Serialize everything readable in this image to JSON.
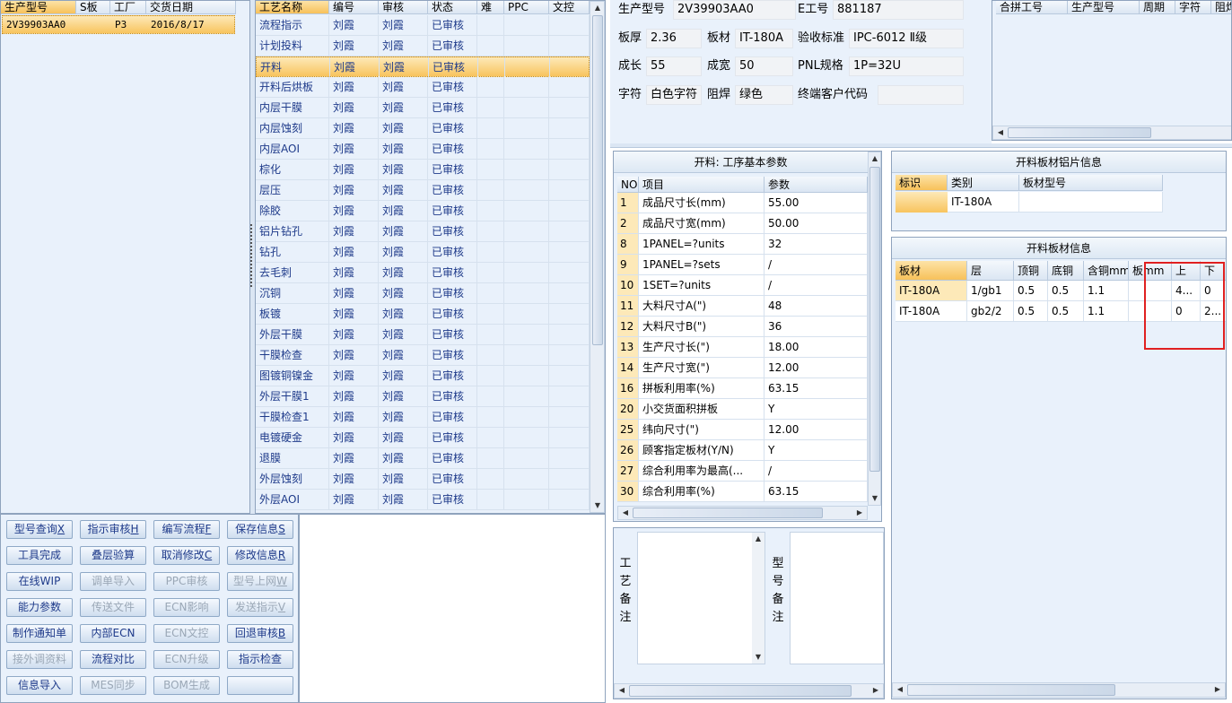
{
  "left_grid": {
    "headers": [
      "生产型号",
      "S板",
      "工厂",
      "交货日期"
    ],
    "rows": [
      {
        "model": "2V39903AA0",
        "s": "",
        "factory": "P3",
        "date": "2016/8/17"
      }
    ]
  },
  "process_grid": {
    "headers": [
      "工艺名称",
      "编号",
      "审核",
      "状态",
      "难",
      "PPC",
      "文控"
    ],
    "rows": [
      {
        "name": "流程指示",
        "no": "刘霞",
        "audit": "刘霞",
        "status": "已审核"
      },
      {
        "name": "计划投料",
        "no": "刘霞",
        "audit": "刘霞",
        "status": "已审核"
      },
      {
        "name": "开料",
        "no": "刘霞",
        "audit": "刘霞",
        "status": "已审核"
      },
      {
        "name": "开料后烘板",
        "no": "刘霞",
        "audit": "刘霞",
        "status": "已审核"
      },
      {
        "name": "内层干膜",
        "no": "刘霞",
        "audit": "刘霞",
        "status": "已审核"
      },
      {
        "name": "内层蚀刻",
        "no": "刘霞",
        "audit": "刘霞",
        "status": "已审核"
      },
      {
        "name": "内层AOI",
        "no": "刘霞",
        "audit": "刘霞",
        "status": "已审核"
      },
      {
        "name": "棕化",
        "no": "刘霞",
        "audit": "刘霞",
        "status": "已审核"
      },
      {
        "name": "层压",
        "no": "刘霞",
        "audit": "刘霞",
        "status": "已审核"
      },
      {
        "name": "除胶",
        "no": "刘霞",
        "audit": "刘霞",
        "status": "已审核"
      },
      {
        "name": "铝片钻孔",
        "no": "刘霞",
        "audit": "刘霞",
        "status": "已审核"
      },
      {
        "name": "钻孔",
        "no": "刘霞",
        "audit": "刘霞",
        "status": "已审核"
      },
      {
        "name": "去毛刺",
        "no": "刘霞",
        "audit": "刘霞",
        "status": "已审核"
      },
      {
        "name": "沉铜",
        "no": "刘霞",
        "audit": "刘霞",
        "status": "已审核"
      },
      {
        "name": "板镀",
        "no": "刘霞",
        "audit": "刘霞",
        "status": "已审核"
      },
      {
        "name": "外层干膜",
        "no": "刘霞",
        "audit": "刘霞",
        "status": "已审核"
      },
      {
        "name": "干膜检查",
        "no": "刘霞",
        "audit": "刘霞",
        "status": "已审核"
      },
      {
        "name": "图镀铜镍金",
        "no": "刘霞",
        "audit": "刘霞",
        "status": "已审核"
      },
      {
        "name": "外层干膜1",
        "no": "刘霞",
        "audit": "刘霞",
        "status": "已审核"
      },
      {
        "name": "干膜检查1",
        "no": "刘霞",
        "audit": "刘霞",
        "status": "已审核"
      },
      {
        "name": "电镀硬金",
        "no": "刘霞",
        "audit": "刘霞",
        "status": "已审核"
      },
      {
        "name": "退膜",
        "no": "刘霞",
        "audit": "刘霞",
        "status": "已审核"
      },
      {
        "name": "外层蚀刻",
        "no": "刘霞",
        "audit": "刘霞",
        "status": "已审核"
      },
      {
        "name": "外层AOI",
        "no": "刘霞",
        "audit": "刘霞",
        "status": "已审核"
      }
    ]
  },
  "buttons": [
    {
      "label": "型号查询",
      "key": "X",
      "disabled": false
    },
    {
      "label": "指示审核",
      "key": "H",
      "disabled": false
    },
    {
      "label": "编写流程",
      "key": "F",
      "disabled": false
    },
    {
      "label": "保存信息",
      "key": "S",
      "disabled": false
    },
    {
      "label": "工具完成",
      "key": "",
      "disabled": false
    },
    {
      "label": "叠层验算",
      "key": "",
      "disabled": false
    },
    {
      "label": "取消修改",
      "key": "C",
      "disabled": false
    },
    {
      "label": "修改信息",
      "key": "R",
      "disabled": false
    },
    {
      "label": "在线WIP",
      "key": "",
      "disabled": false
    },
    {
      "label": "调单导入",
      "key": "",
      "disabled": true
    },
    {
      "label": "PPC审核",
      "key": "",
      "disabled": true
    },
    {
      "label": "型号上网",
      "key": "W",
      "disabled": true
    },
    {
      "label": "能力参数",
      "key": "",
      "disabled": false
    },
    {
      "label": "传送文件",
      "key": "",
      "disabled": true
    },
    {
      "label": "ECN影响",
      "key": "",
      "disabled": true
    },
    {
      "label": "发送指示",
      "key": "V",
      "disabled": true
    },
    {
      "label": "制作通知单",
      "key": "",
      "disabled": false
    },
    {
      "label": "内部ECN",
      "key": "",
      "disabled": false
    },
    {
      "label": "ECN文控",
      "key": "",
      "disabled": true
    },
    {
      "label": "回退审核",
      "key": "B",
      "disabled": false
    },
    {
      "label": "接外调资料",
      "key": "",
      "disabled": true
    },
    {
      "label": "流程对比",
      "key": "",
      "disabled": false
    },
    {
      "label": "ECN升级",
      "key": "",
      "disabled": true
    },
    {
      "label": "指示检查",
      "key": "",
      "disabled": false
    },
    {
      "label": "信息导入",
      "key": "",
      "disabled": false
    },
    {
      "label": "MES同步",
      "key": "",
      "disabled": true
    },
    {
      "label": "BOM生成",
      "key": "",
      "disabled": true
    },
    {
      "label": "",
      "key": "",
      "disabled": false
    }
  ],
  "info": {
    "model_label": "生产型号",
    "model": "2V39903AA0",
    "e_label": "E工号",
    "e_no": "881187",
    "thick_label": "板厚",
    "thick": "2.36",
    "material_label": "板材",
    "material": "IT-180A",
    "std_label": "验收标准",
    "std": "IPC-6012 Ⅱ级",
    "len_label": "成长",
    "len": "55",
    "wid_label": "成宽",
    "wid": "50",
    "pnl_label": "PNL规格",
    "pnl": "1P=32U",
    "char_label": "字符",
    "char": "白色字符",
    "mask_label": "阻焊",
    "mask": "绿色",
    "cust_label": "终端客户代码",
    "cust": ""
  },
  "merge_grid": {
    "headers": [
      "合拼工号",
      "生产型号",
      "周期",
      "字符",
      "阻焊"
    ]
  },
  "params": {
    "title": "开料: 工序基本参数",
    "headers": [
      "NO",
      "项目",
      "参数"
    ],
    "rows": [
      {
        "no": "1",
        "item": "成品尺寸长(mm)",
        "val": "55.00"
      },
      {
        "no": "2",
        "item": "成品尺寸宽(mm)",
        "val": "50.00"
      },
      {
        "no": "8",
        "item": "1PANEL=?units",
        "val": "32"
      },
      {
        "no": "9",
        "item": "1PANEL=?sets",
        "val": "/"
      },
      {
        "no": "10",
        "item": "1SET=?units",
        "val": "/"
      },
      {
        "no": "11",
        "item": "大料尺寸A(\")",
        "val": "48"
      },
      {
        "no": "12",
        "item": "大料尺寸B(\")",
        "val": "36"
      },
      {
        "no": "13",
        "item": "生产尺寸长(\")",
        "val": "18.00"
      },
      {
        "no": "14",
        "item": "生产尺寸宽(\")",
        "val": "12.00"
      },
      {
        "no": "16",
        "item": "拼板利用率(%)",
        "val": "63.15"
      },
      {
        "no": "20",
        "item": "小交货面积拼板",
        "val": "Y"
      },
      {
        "no": "25",
        "item": "纬向尺寸(\")",
        "val": "12.00"
      },
      {
        "no": "26",
        "item": "顾客指定板材(Y/N)",
        "val": "Y"
      },
      {
        "no": "27",
        "item": "综合利用率为最高(...",
        "val": "/"
      },
      {
        "no": "30",
        "item": "综合利用率(%)",
        "val": "63.15"
      }
    ]
  },
  "foil": {
    "title": "开料板材铝片信息",
    "headers": [
      "标识",
      "类别",
      "板材型号"
    ],
    "rows": [
      {
        "id": "",
        "type": "IT-180A",
        "model": ""
      }
    ]
  },
  "material_info": {
    "title": "开料板材信息",
    "headers": [
      "板材",
      "层",
      "顶铜",
      "底铜",
      "含铜mm",
      "板mm",
      "上",
      "下"
    ],
    "rows": [
      {
        "mat": "IT-180A",
        "layer": "1/gb1",
        "top": "0.5",
        "bot": "0.5",
        "cu": "1.1",
        "b": "",
        "up": "4...",
        "down": "0"
      },
      {
        "mat": "IT-180A",
        "layer": "gb2/2",
        "top": "0.5",
        "bot": "0.5",
        "cu": "1.1",
        "b": "",
        "up": "0",
        "down": "2..."
      }
    ]
  },
  "notes": {
    "process_label": "工艺备注",
    "model_label": "型号备注"
  },
  "colors": {
    "accent": "#f8c45e",
    "highlight_box": "#e02020"
  }
}
